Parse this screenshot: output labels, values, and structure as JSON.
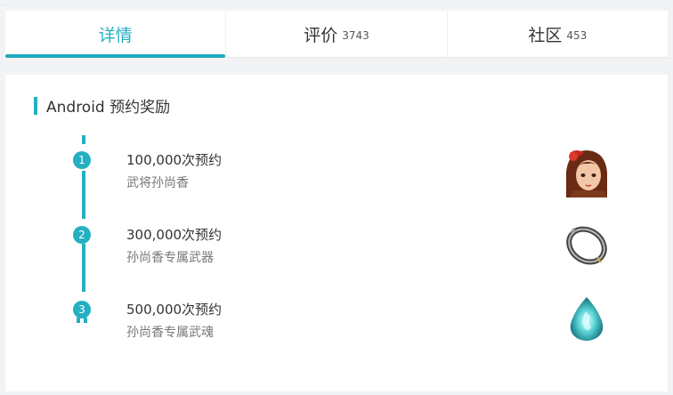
{
  "tabs": [
    {
      "label": "详情",
      "count": ""
    },
    {
      "label": "评价",
      "count": "3743"
    },
    {
      "label": "社区",
      "count": "453"
    }
  ],
  "section": {
    "title": "Android 预约奖励"
  },
  "rewards": [
    {
      "step": "1",
      "milestone": "100,000次预约",
      "reward": "武将孙尚香",
      "icon": "character-portrait-icon"
    },
    {
      "step": "2",
      "milestone": "300,000次预约",
      "reward": "孙尚香专属武器",
      "icon": "ring-weapon-icon"
    },
    {
      "step": "3",
      "milestone": "500,000次预约",
      "reward": "孙尚香专属武魂",
      "icon": "spirit-flame-icon"
    }
  ],
  "colors": {
    "accent": "#24afc2",
    "background": "#f2f3f4"
  }
}
